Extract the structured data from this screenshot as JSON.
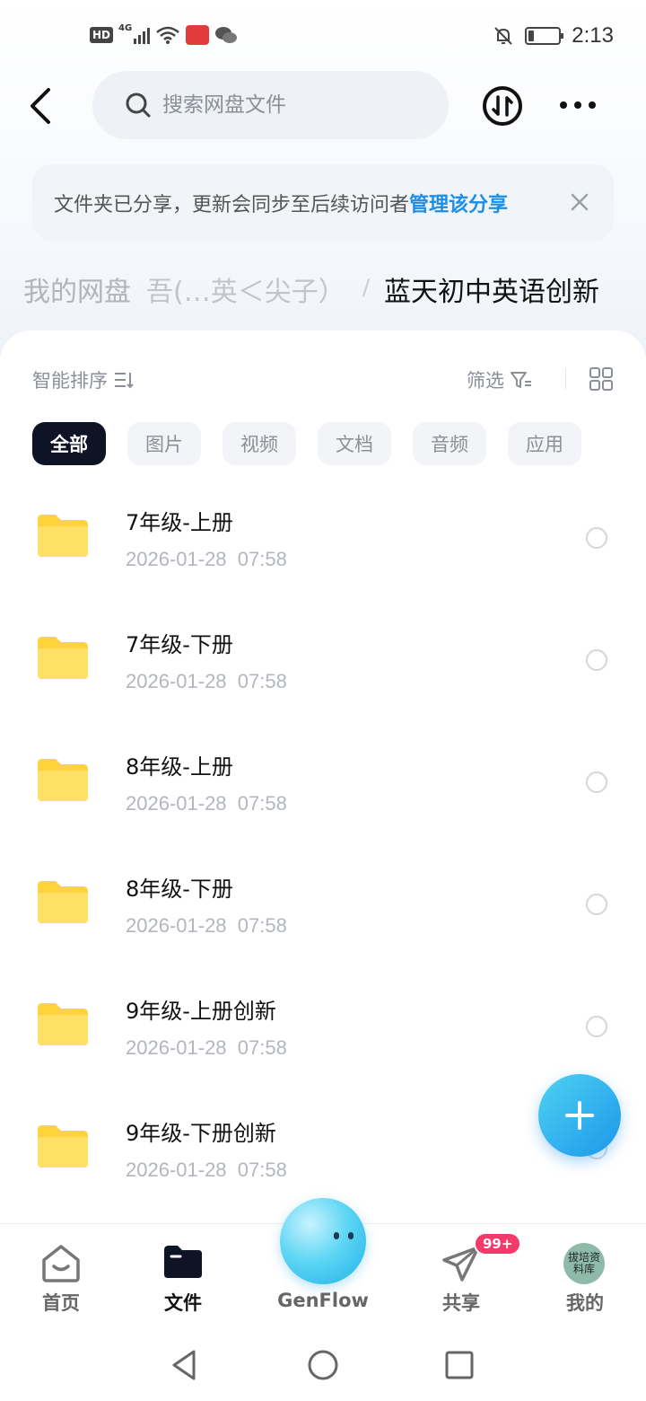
{
  "status_bar": {
    "hd": "HD",
    "network": "4G",
    "time": "2:13",
    "battery_level": 0.18,
    "icons": [
      "signal-icon",
      "wifi-icon",
      "app-notification-icon",
      "wechat-icon",
      "bell-muted-icon",
      "battery-icon"
    ]
  },
  "header": {
    "search_placeholder": "搜索网盘文件",
    "icons": [
      "back-icon",
      "search-icon",
      "transfer-icon",
      "more-icon"
    ]
  },
  "notice": {
    "message": "文件夹已分享，更新会同步至后续访问者",
    "link": "管理该分享",
    "link_color": "#1d8ee8"
  },
  "breadcrumb": {
    "root": "我的网盘",
    "middle": "吾(…英＜尖子）",
    "separator": "/",
    "current": "蓝天初中英语创新"
  },
  "toolbar": {
    "sort_label": "智能排序",
    "filter_label": "筛选"
  },
  "chips": [
    {
      "label": "全部",
      "active": true
    },
    {
      "label": "图片",
      "active": false
    },
    {
      "label": "视频",
      "active": false
    },
    {
      "label": "文档",
      "active": false
    },
    {
      "label": "音频",
      "active": false
    },
    {
      "label": "应用",
      "active": false
    }
  ],
  "files": [
    {
      "name": "7年级-上册",
      "date": "2026-01-28  07:58"
    },
    {
      "name": "7年级-下册",
      "date": "2026-01-28  07:58"
    },
    {
      "name": "8年级-上册",
      "date": "2026-01-28  07:58"
    },
    {
      "name": "8年级-下册",
      "date": "2026-01-28  07:58"
    },
    {
      "name": "9年级-上册创新",
      "date": "2026-01-28  07:58"
    },
    {
      "name": "9年级-下册创新",
      "date": "2026-01-28  07:58"
    }
  ],
  "bottom_nav": {
    "home": "首页",
    "files": "文件",
    "genflow": "GenFlow",
    "share": "共享",
    "share_badge": "99+",
    "mine": "我的",
    "avatar_text": "拔培资料库"
  },
  "colors": {
    "active_chip": "#0e1426",
    "fab": "#1b97ea",
    "badge": "#f23b6a",
    "folder": "#ffd43b"
  }
}
